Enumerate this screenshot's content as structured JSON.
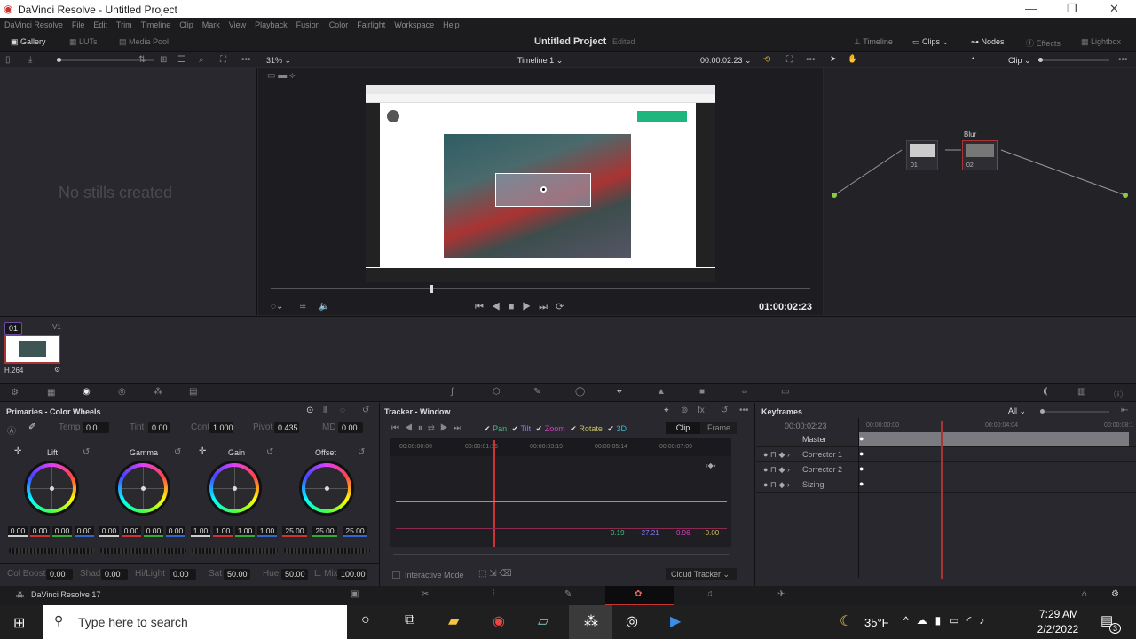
{
  "window": {
    "title": "DaVinci Resolve - Untitled Project",
    "min": "—",
    "max": "❐",
    "close": "✕"
  },
  "menu": [
    "DaVinci Resolve",
    "File",
    "Edit",
    "Trim",
    "Timeline",
    "Clip",
    "Mark",
    "View",
    "Playback",
    "Fusion",
    "Color",
    "Fairlight",
    "Workspace",
    "Help"
  ],
  "header": {
    "left": [
      "Gallery",
      "LUTs",
      "Media Pool"
    ],
    "project": "Untitled Project",
    "status": "Edited",
    "right": [
      "Timeline",
      "Clips",
      "Nodes",
      "Effects",
      "Lightbox"
    ]
  },
  "toolbar": {
    "zoom": "31%",
    "timeline": "Timeline 1",
    "timecode": "00:00:02:23",
    "clip_mode": "Clip"
  },
  "gallery": {
    "empty": "No stills created"
  },
  "viewer": {
    "timecode": "01:00:02:23"
  },
  "nodes": [
    {
      "label": "",
      "num": "01"
    },
    {
      "label": "Blur",
      "num": "02"
    }
  ],
  "clip": {
    "index": "01",
    "track": "V1",
    "codec": "H.264"
  },
  "primaries": {
    "title": "Primaries - Color Wheels",
    "top": [
      {
        "label": "Temp",
        "value": "0.0"
      },
      {
        "label": "Tint",
        "value": "0.00"
      },
      {
        "label": "Cont",
        "value": "1.000"
      },
      {
        "label": "Pivot",
        "value": "0.435"
      },
      {
        "label": "MD",
        "value": "0.00"
      }
    ],
    "wheels": [
      {
        "name": "Lift",
        "values": [
          "0.00",
          "0.00",
          "0.00",
          "0.00"
        ]
      },
      {
        "name": "Gamma",
        "values": [
          "0.00",
          "0.00",
          "0.00",
          "0.00"
        ]
      },
      {
        "name": "Gain",
        "values": [
          "1.00",
          "1.00",
          "1.00",
          "1.00"
        ]
      },
      {
        "name": "Offset",
        "values": [
          "25.00",
          "25.00",
          "25.00"
        ]
      }
    ],
    "bottom": [
      {
        "label": "Col Boost",
        "value": "0.00"
      },
      {
        "label": "Shad",
        "value": "0.00"
      },
      {
        "label": "Hi/Light",
        "value": "0.00"
      },
      {
        "label": "Sat",
        "value": "50.00"
      },
      {
        "label": "Hue",
        "value": "50.00"
      },
      {
        "label": "L. Mix",
        "value": "100.00"
      }
    ]
  },
  "tracker": {
    "title": "Tracker - Window",
    "checks": [
      "Pan",
      "Tilt",
      "Zoom",
      "Rotate",
      "3D"
    ],
    "modes": [
      "Clip",
      "Frame"
    ],
    "ruler": [
      "00:00:00:00",
      "00:00:01:15",
      "00:00:03:19",
      "00:00:05:14",
      "00:00:07:09"
    ],
    "readouts": [
      "0.19",
      "-27.21",
      "0.96",
      "-0.00"
    ],
    "interactive": "Interactive Mode",
    "cloud": "Cloud Tracker"
  },
  "keyframes": {
    "title": "Keyframes",
    "filter": "All",
    "timecode": "00:00:02:23",
    "ruler": [
      "00:00:00:00",
      "00:00:04:04",
      "00:00:08:1"
    ],
    "rows": [
      "Master",
      "Corrector 1",
      "Corrector 2",
      "Sizing"
    ]
  },
  "pagebar": {
    "app": "DaVinci Resolve 17"
  },
  "taskbar": {
    "search": "Type here to search",
    "weather": "35°F",
    "time": "7:29 AM",
    "date": "2/2/2022",
    "notif": "3"
  },
  "colors": {
    "accent": "#e0383e",
    "pan": "#3fbf7f",
    "tilt": "#7b7bff",
    "zoom": "#d040c0",
    "rotate": "#c8c060",
    "three_d": "#40b8c8"
  }
}
